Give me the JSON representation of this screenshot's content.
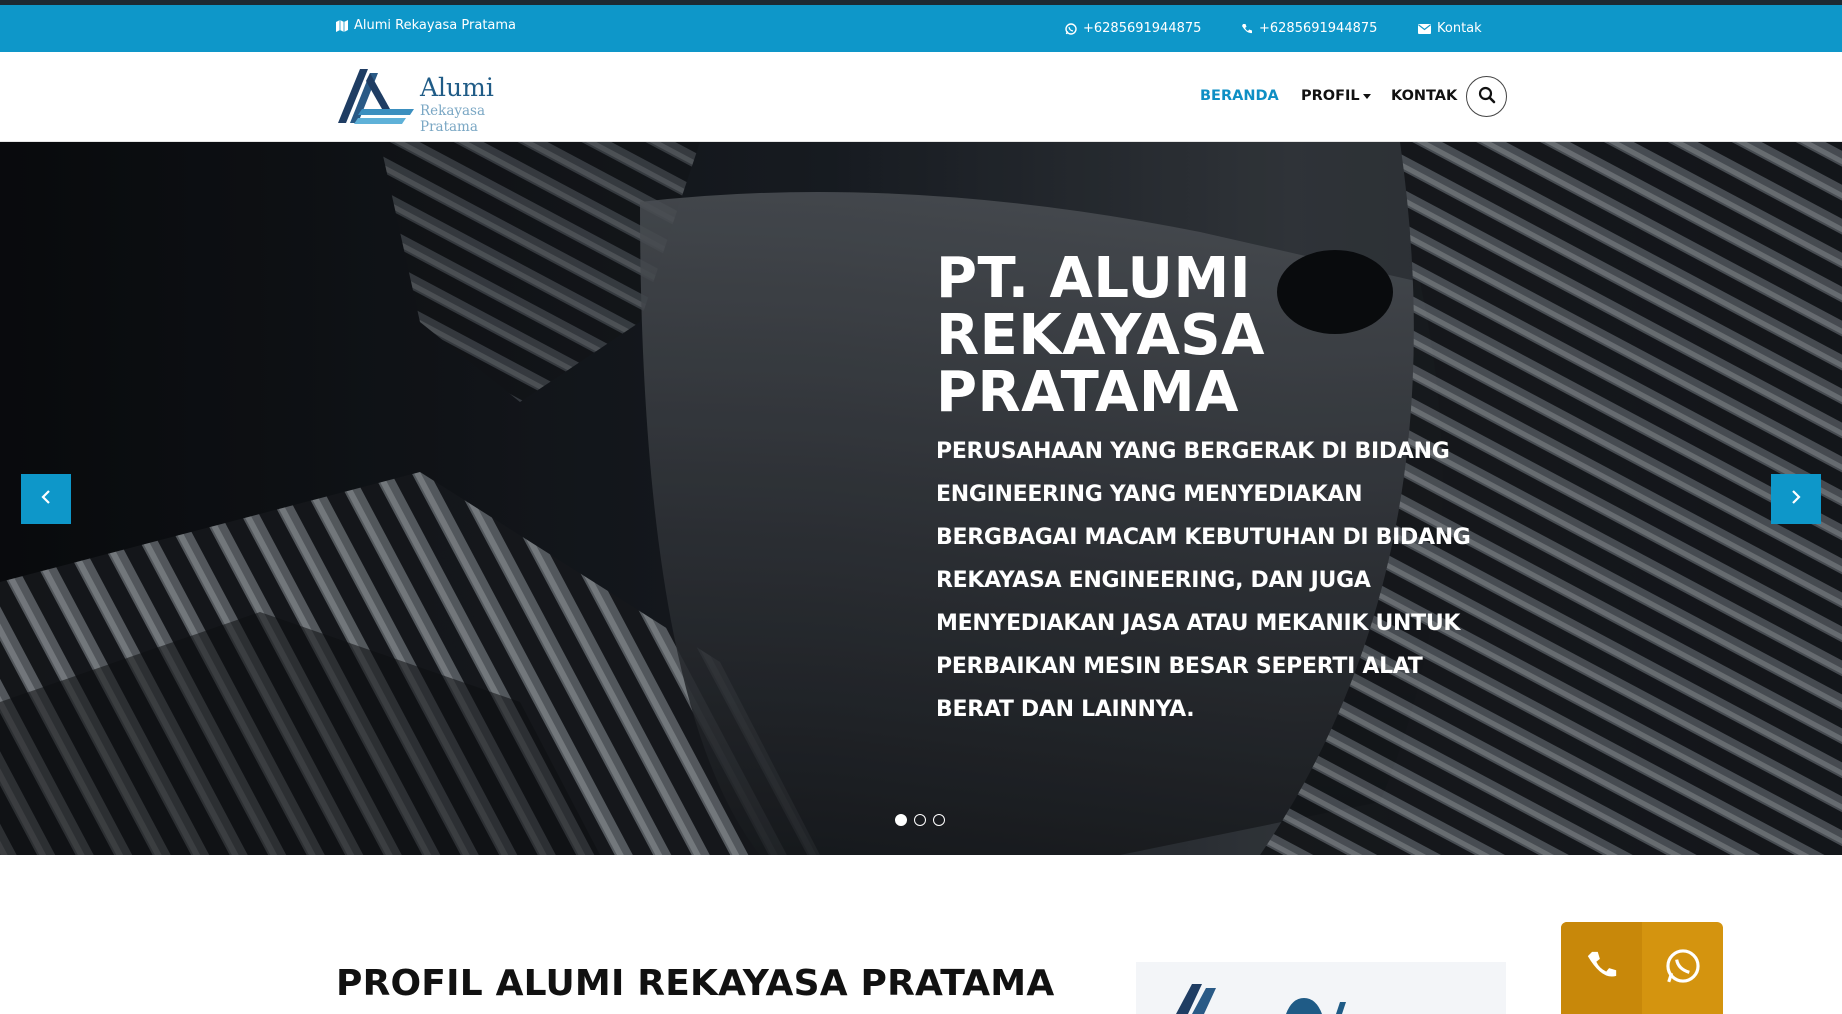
{
  "topbar": {
    "brand_label": "Alumi Rekayasa Pratama",
    "whatsapp": "+6285691944875",
    "phone": "+6285691944875",
    "contact_label": "Kontak"
  },
  "header": {
    "logo_name": "Alumi",
    "logo_sub": "Rekayasa Pratama",
    "nav": {
      "home": "BERANDA",
      "profile": "PROFIL",
      "contact": "KONTAK"
    }
  },
  "hero": {
    "title": "PT. ALUMI REKAYASA PRATAMA",
    "subtitle": "PERUSAHAAN YANG BERGERAK DI BIDANG ENGINEERING YANG MENYEDIAKAN BERGBAGAI MACAM KEBUTUHAN DI BIDANG REKAYASA ENGINEERING, DAN JUGA MENYEDIAKAN JASA ATAU MEKANIK UNTUK PERBAIKAN MESIN BESAR SEPERTI ALAT BERAT DAN LAINNYA.",
    "slides_total": 3,
    "active_slide": 1
  },
  "profile": {
    "heading": "PROFIL ALUMI REKAYASA PRATAMA"
  },
  "colors": {
    "accent": "#0e97c9",
    "active_nav": "#0e8fc4",
    "float_button": "#d4940f"
  },
  "icons": {
    "brand": "map-icon",
    "whatsapp": "whatsapp-icon",
    "phone": "phone-icon",
    "contact": "envelope-icon",
    "search": "search-icon",
    "prev": "chevron-left-icon",
    "next": "chevron-right-icon"
  }
}
